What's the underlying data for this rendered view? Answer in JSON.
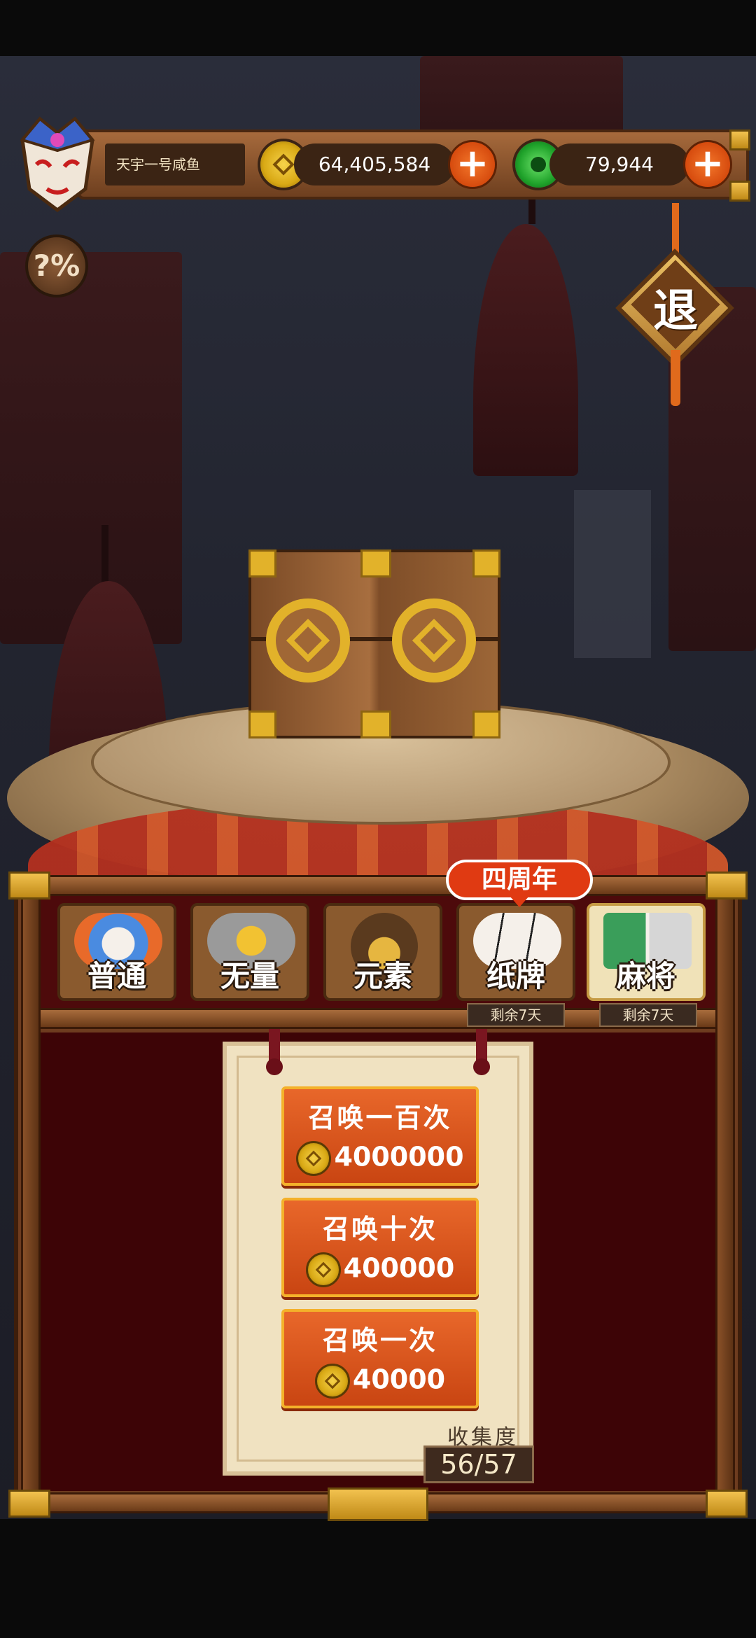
{
  "player": {
    "name": "天宇一号咸鱼",
    "coins": "64,405,584",
    "gems": "79,944"
  },
  "top_buttons": {
    "rate_label": "?%",
    "exit_label": "退"
  },
  "tabs": [
    {
      "label": "普通",
      "active": false
    },
    {
      "label": "无量",
      "active": false
    },
    {
      "label": "元素",
      "active": false
    },
    {
      "label": "纸牌",
      "active": false,
      "remaining": "剩余7天"
    },
    {
      "label": "麻将",
      "active": true,
      "remaining": "剩余7天"
    }
  ],
  "anniversary_badge": "四周年",
  "summons": [
    {
      "title": "召唤一百次",
      "cost": "4000000"
    },
    {
      "title": "召唤十次",
      "cost": "400000"
    },
    {
      "title": "召唤一次",
      "cost": "40000"
    }
  ],
  "collection": {
    "label": "收集度",
    "value": "56/57"
  }
}
